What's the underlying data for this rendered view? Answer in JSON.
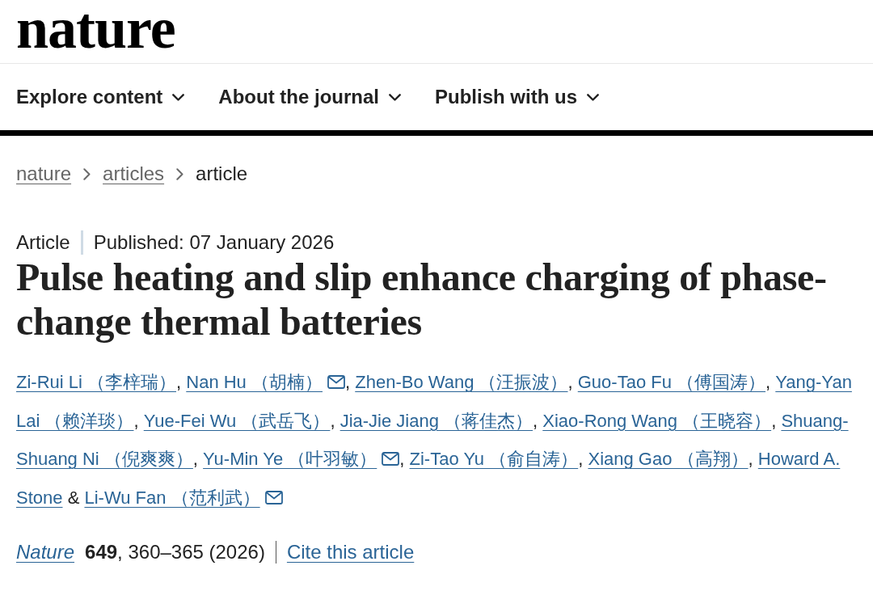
{
  "header": {
    "logo": "nature"
  },
  "nav": {
    "items": [
      {
        "label": "Explore content"
      },
      {
        "label": "About the journal"
      },
      {
        "label": "Publish with us"
      }
    ]
  },
  "breadcrumb": [
    {
      "label": "nature",
      "kind": "link"
    },
    {
      "label": "articles",
      "kind": "link"
    },
    {
      "label": "article",
      "kind": "current"
    }
  ],
  "article": {
    "type": "Article",
    "published": "Published: 07 January 2026",
    "title": "Pulse heating and slip enhance charging of phase-change thermal batteries",
    "authors": [
      {
        "name_lines": [
          "Zi-Rui Li （李梓瑞）"
        ],
        "email": false,
        "after": ","
      },
      {
        "name_lines": [
          "Nan Hu （胡楠）"
        ],
        "email": true,
        "after": ","
      },
      {
        "name_lines": [
          "Zhen-Bo Wang （汪振波）"
        ],
        "email": false,
        "after": ","
      },
      {
        "name_lines": [
          "Guo-Tao Fu （傅国涛）"
        ],
        "email": false,
        "after": ","
      },
      {
        "name_lines": [
          "Yang-Yan",
          "Lai （赖洋琰）"
        ],
        "email": false,
        "after": ","
      },
      {
        "name_lines": [
          "Yue-Fei Wu （武岳飞）"
        ],
        "email": false,
        "after": ","
      },
      {
        "name_lines": [
          "Jia-Jie Jiang （蒋佳杰）"
        ],
        "email": false,
        "after": ","
      },
      {
        "name_lines": [
          "Xiao-Rong Wang （王晓容）"
        ],
        "email": false,
        "after": ","
      },
      {
        "name_lines": [
          "Shuang-",
          "Shuang Ni （倪爽爽）"
        ],
        "email": false,
        "after": ","
      },
      {
        "name_lines": [
          "Yu-Min Ye （叶羽敏）"
        ],
        "email": true,
        "after": ","
      },
      {
        "name_lines": [
          "Zi-Tao Yu （俞自涛）"
        ],
        "email": false,
        "after": ","
      },
      {
        "name_lines": [
          "Xiang Gao （高翔）"
        ],
        "email": false,
        "after": ","
      },
      {
        "name_lines": [
          "Howard A.",
          "Stone"
        ],
        "email": false
      },
      {
        "before": "&",
        "name_lines": [
          "Li-Wu Fan （范利武）"
        ],
        "email": true
      }
    ],
    "citation": {
      "journal": "Nature",
      "details": "**649**, 360–365 (2026)",
      "cite_link": "Cite this article"
    }
  }
}
